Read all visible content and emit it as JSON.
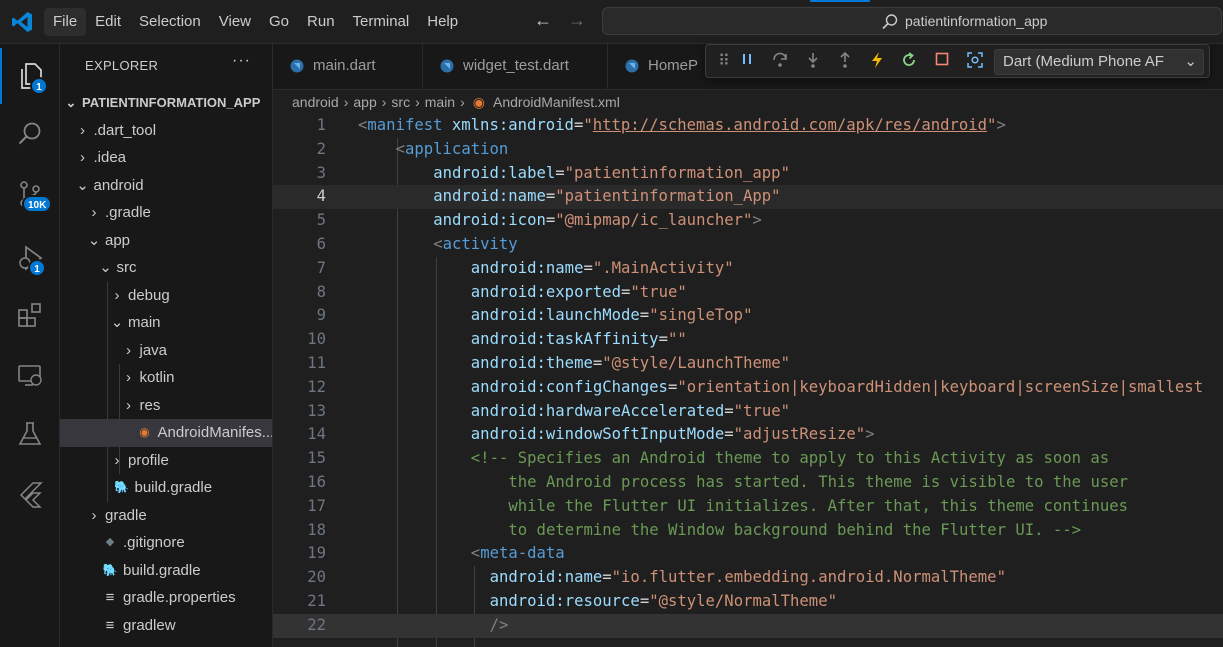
{
  "menu": [
    "File",
    "Edit",
    "Selection",
    "View",
    "Go",
    "Run",
    "Terminal",
    "Help"
  ],
  "command_center": "patientinformation_app",
  "activity_badges": {
    "explorer": "1",
    "source_control": "10K",
    "run_debug": "1"
  },
  "sidebar": {
    "title": "EXPLORER",
    "more": "···",
    "tree": [
      {
        "label": "PATIENTINFORMATION_APP",
        "depth": 0,
        "chev": "⌄",
        "type": "root"
      },
      {
        "label": ".dart_tool",
        "depth": 1,
        "chev": "›",
        "type": "folder"
      },
      {
        "label": ".idea",
        "depth": 1,
        "chev": "›",
        "type": "folder"
      },
      {
        "label": "android",
        "depth": 1,
        "chev": "⌄",
        "type": "folder"
      },
      {
        "label": ".gradle",
        "depth": 2,
        "chev": "›",
        "type": "folder"
      },
      {
        "label": "app",
        "depth": 2,
        "chev": "⌄",
        "type": "folder"
      },
      {
        "label": "src",
        "depth": 3,
        "chev": "⌄",
        "type": "folder"
      },
      {
        "label": "debug",
        "depth": 4,
        "chev": "›",
        "type": "folder"
      },
      {
        "label": "main",
        "depth": 4,
        "chev": "⌄",
        "type": "folder"
      },
      {
        "label": "java",
        "depth": 5,
        "chev": "›",
        "type": "folder"
      },
      {
        "label": "kotlin",
        "depth": 5,
        "chev": "›",
        "type": "folder"
      },
      {
        "label": "res",
        "depth": 5,
        "chev": "›",
        "type": "folder"
      },
      {
        "label": "AndroidManifes...",
        "depth": 5,
        "icon": "rss",
        "type": "file",
        "selected": true
      },
      {
        "label": "profile",
        "depth": 4,
        "chev": "›",
        "type": "folder"
      },
      {
        "label": "build.gradle",
        "depth": 3,
        "icon": "gradle",
        "type": "file"
      },
      {
        "label": "gradle",
        "depth": 2,
        "chev": "›",
        "type": "folder"
      },
      {
        "label": ".gitignore",
        "depth": 2,
        "icon": "gear",
        "type": "file"
      },
      {
        "label": "build.gradle",
        "depth": 2,
        "icon": "gradle",
        "type": "file"
      },
      {
        "label": "gradle.properties",
        "depth": 2,
        "icon": "lines",
        "type": "file"
      },
      {
        "label": "gradlew",
        "depth": 2,
        "icon": "lines",
        "type": "file"
      }
    ]
  },
  "tabs": [
    "main.dart",
    "widget_test.dart",
    "HomeP"
  ],
  "debug": {
    "target": "Dart (Medium Phone AF"
  },
  "breadcrumb": [
    "android",
    "app",
    "src",
    "main",
    "AndroidManifest.xml"
  ],
  "code": [
    {
      "n": "1",
      "indent": 0,
      "tokens": [
        [
          "p",
          "<"
        ],
        [
          "t",
          "manifest"
        ],
        [
          "w",
          " "
        ],
        [
          "a",
          "xmlns:android"
        ],
        [
          "w",
          "="
        ],
        [
          "s",
          "\""
        ],
        [
          "u",
          "http://schemas.android.com/apk/res/android"
        ],
        [
          "s",
          "\""
        ],
        [
          "p",
          ">"
        ]
      ]
    },
    {
      "n": "2",
      "indent": 1,
      "tokens": [
        [
          "p",
          "<"
        ],
        [
          "t",
          "application"
        ]
      ]
    },
    {
      "n": "3",
      "indent": 2,
      "tokens": [
        [
          "a",
          "android:label"
        ],
        [
          "w",
          "="
        ],
        [
          "s",
          "\"patientinformation_app\""
        ]
      ]
    },
    {
      "n": "4",
      "indent": 2,
      "tokens": [
        [
          "a",
          "android:name"
        ],
        [
          "w",
          "="
        ],
        [
          "s",
          "\"patientinformation_App\""
        ]
      ]
    },
    {
      "n": "5",
      "indent": 2,
      "tokens": [
        [
          "a",
          "android:icon"
        ],
        [
          "w",
          "="
        ],
        [
          "s",
          "\"@mipmap/ic_launcher\""
        ],
        [
          "p",
          ">"
        ]
      ]
    },
    {
      "n": "6",
      "indent": 2,
      "tokens": [
        [
          "p",
          "<"
        ],
        [
          "t",
          "activity"
        ]
      ]
    },
    {
      "n": "7",
      "indent": 3,
      "tokens": [
        [
          "a",
          "android:name"
        ],
        [
          "w",
          "="
        ],
        [
          "s",
          "\".MainActivity\""
        ]
      ]
    },
    {
      "n": "8",
      "indent": 3,
      "tokens": [
        [
          "a",
          "android:exported"
        ],
        [
          "w",
          "="
        ],
        [
          "s",
          "\"true\""
        ]
      ]
    },
    {
      "n": "9",
      "indent": 3,
      "tokens": [
        [
          "a",
          "android:launchMode"
        ],
        [
          "w",
          "="
        ],
        [
          "s",
          "\"singleTop\""
        ]
      ]
    },
    {
      "n": "10",
      "indent": 3,
      "tokens": [
        [
          "a",
          "android:taskAffinity"
        ],
        [
          "w",
          "="
        ],
        [
          "s",
          "\"\""
        ]
      ]
    },
    {
      "n": "11",
      "indent": 3,
      "tokens": [
        [
          "a",
          "android:theme"
        ],
        [
          "w",
          "="
        ],
        [
          "s",
          "\"@style/LaunchTheme\""
        ]
      ]
    },
    {
      "n": "12",
      "indent": 3,
      "tokens": [
        [
          "a",
          "android:configChanges"
        ],
        [
          "w",
          "="
        ],
        [
          "s",
          "\"orientation|keyboardHidden|keyboard|screenSize|smallest"
        ]
      ]
    },
    {
      "n": "13",
      "indent": 3,
      "tokens": [
        [
          "a",
          "android:hardwareAccelerated"
        ],
        [
          "w",
          "="
        ],
        [
          "s",
          "\"true\""
        ]
      ]
    },
    {
      "n": "14",
      "indent": 3,
      "tokens": [
        [
          "a",
          "android:windowSoftInputMode"
        ],
        [
          "w",
          "="
        ],
        [
          "s",
          "\"adjustResize\""
        ],
        [
          "p",
          ">"
        ]
      ]
    },
    {
      "n": "15",
      "indent": 3,
      "tokens": [
        [
          "c",
          "<!-- Specifies an Android theme to apply to this Activity as soon as"
        ]
      ]
    },
    {
      "n": "16",
      "indent": 4,
      "tokens": [
        [
          "c",
          "the Android process has started. This theme is visible to the user"
        ]
      ]
    },
    {
      "n": "17",
      "indent": 4,
      "tokens": [
        [
          "c",
          "while the Flutter UI initializes. After that, this theme continues"
        ]
      ]
    },
    {
      "n": "18",
      "indent": 4,
      "tokens": [
        [
          "c",
          "to determine the Window background behind the Flutter UI. -->"
        ]
      ]
    },
    {
      "n": "19",
      "indent": 3,
      "tokens": [
        [
          "p",
          "<"
        ],
        [
          "t",
          "meta-data"
        ]
      ]
    },
    {
      "n": "20",
      "indent": 3.5,
      "tokens": [
        [
          "a",
          "android:name"
        ],
        [
          "w",
          "="
        ],
        [
          "s",
          "\"io.flutter.embedding.android.NormalTheme\""
        ]
      ]
    },
    {
      "n": "21",
      "indent": 3.5,
      "tokens": [
        [
          "a",
          "android:resource"
        ],
        [
          "w",
          "="
        ],
        [
          "s",
          "\"@style/NormalTheme\""
        ]
      ]
    },
    {
      "n": "22",
      "indent": 3.5,
      "tokens": [
        [
          "p",
          "/>"
        ]
      ]
    }
  ],
  "colors": {
    "accent": "#0078d4",
    "background": "#1f1f1f",
    "sidebar": "#181818"
  }
}
